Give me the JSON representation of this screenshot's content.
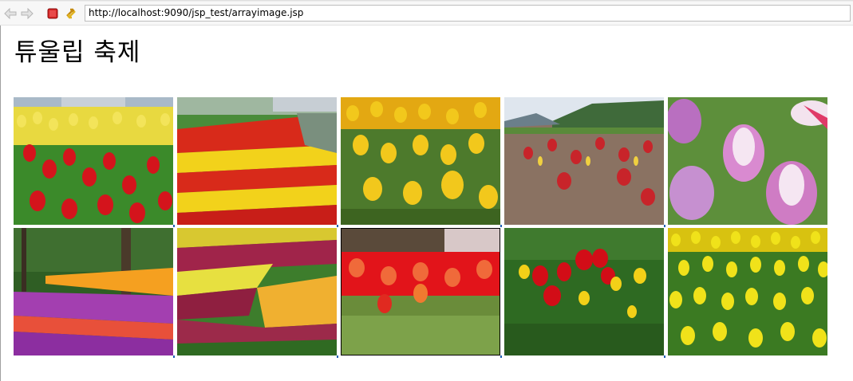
{
  "browser": {
    "url": "http://localhost:9090/jsp_test/arrayimage.jsp",
    "buttons": [
      {
        "icon": "back-arrow-icon"
      },
      {
        "icon": "forward-arrow-icon"
      },
      {
        "icon": "stop-icon"
      },
      {
        "icon": "refresh-icon"
      }
    ]
  },
  "page": {
    "title": "튜울립 축제"
  },
  "gallery": {
    "images": [
      {
        "subject": "red and yellow tulips with building in background",
        "palette": [
          "#e8d940",
          "#d4141c",
          "#3b8a2a"
        ]
      },
      {
        "subject": "long striped tulip beds along a river",
        "palette": [
          "#d82a1a",
          "#f2d21b",
          "#4a8c3a"
        ]
      },
      {
        "subject": "yellow tulips close-up",
        "palette": [
          "#f2c81c",
          "#e3a812",
          "#4d7a2c"
        ]
      },
      {
        "subject": "red-yellow tulips in field with mountain",
        "palette": [
          "#c8242a",
          "#f0d040",
          "#8a7262"
        ]
      },
      {
        "subject": "pink and white tulips close-up",
        "palette": [
          "#d98ad0",
          "#f5e6f2",
          "#5d8f3b"
        ]
      },
      {
        "subject": "purple and orange tulips in park under trees",
        "palette": [
          "#a33fb0",
          "#f5a020",
          "#2f5e24"
        ]
      },
      {
        "subject": "rows of red, yellow and purple tulips",
        "palette": [
          "#a0244a",
          "#e7e040",
          "#3d7d2c"
        ]
      },
      {
        "subject": "red tulips with blurred background",
        "palette": [
          "#e2141a",
          "#f06a3a",
          "#6a8c3a"
        ]
      },
      {
        "subject": "red and yellow tulips in greenery",
        "palette": [
          "#d20d17",
          "#f2d018",
          "#2e6a22"
        ]
      },
      {
        "subject": "field of yellow tulips",
        "palette": [
          "#f0e21a",
          "#d8c210",
          "#3b7a22"
        ]
      }
    ]
  }
}
